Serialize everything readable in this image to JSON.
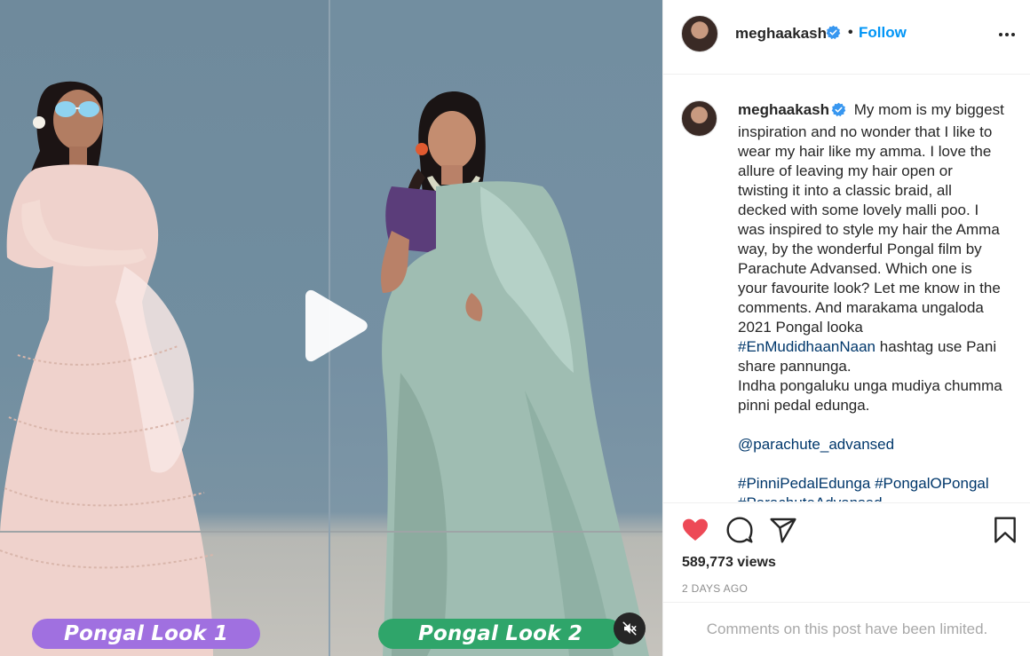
{
  "video": {
    "look1_label": "Pongal Look 1",
    "look2_label": "Pongal Look 2",
    "play_icon": "play-icon",
    "mute_icon": "muted-speaker-icon"
  },
  "header": {
    "username": "meghaakash",
    "separator": "•",
    "follow_label": "Follow",
    "more_icon": "more-options-icon"
  },
  "caption": {
    "username": "meghaakash",
    "text_before_hashtag": " My mom is my biggest inspiration and no wonder that I like to wear my hair like my amma. I love the allure of leaving my hair open or twisting it into a classic braid, all decked with some lovely malli poo. I was inspired to style my hair the Amma way, by the wonderful Pongal film by Parachute Advansed. Which one is your favourite look? Let me know in the comments. And marakama ungaloda 2021 Pongal looka ",
    "hashtag_inline": "#EnMudidhaanNaan",
    "text_after_hashtag": " hashtag use Pani share pannunga.\nIndha pongaluku unga mudiya chumma pinni pedal edunga.",
    "mention": "@parachute_advansed",
    "hashtag_1": "#PinniPedalEdunga",
    "hashtag_2": "#PongalOPongal",
    "hashtag_3": "#ParachuteAdvansed"
  },
  "actions": {
    "like_icon": "heart-filled-icon",
    "comment_icon": "comment-icon",
    "share_icon": "share-icon",
    "save_icon": "bookmark-icon",
    "views": "589,773 views",
    "time_ago": "2 DAYS AGO",
    "like_color": "#ed4956"
  },
  "comments": {
    "limited_notice": "Comments on this post have been limited."
  }
}
